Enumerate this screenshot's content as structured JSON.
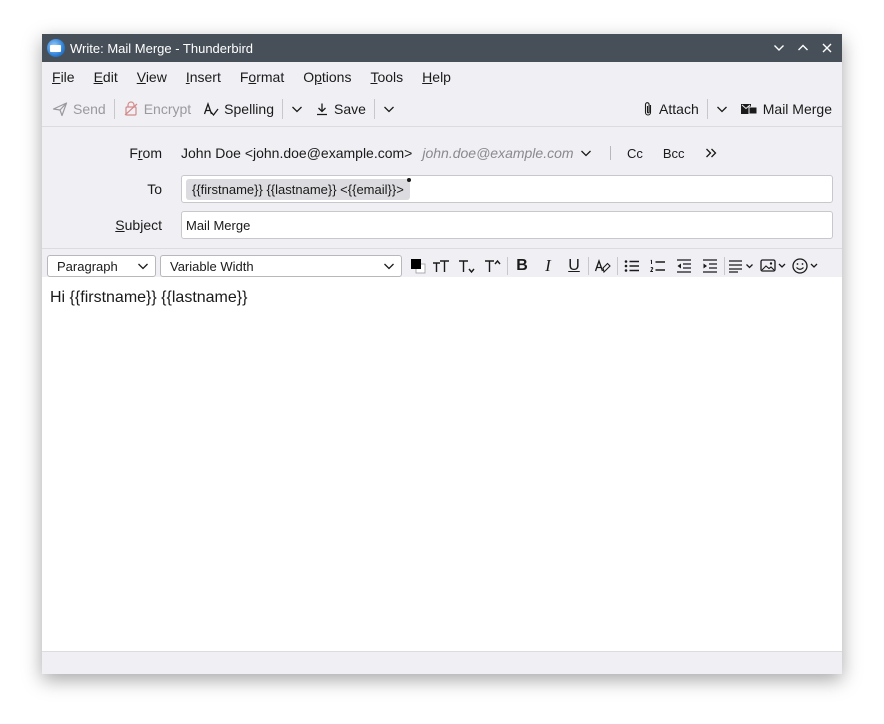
{
  "window": {
    "title": "Write: Mail Merge - Thunderbird"
  },
  "menubar": {
    "items": [
      {
        "pre": "",
        "key": "F",
        "post": "ile"
      },
      {
        "pre": "",
        "key": "E",
        "post": "dit"
      },
      {
        "pre": "",
        "key": "V",
        "post": "iew"
      },
      {
        "pre": "",
        "key": "I",
        "post": "nsert"
      },
      {
        "pre": "F",
        "key": "o",
        "post": "rmat"
      },
      {
        "pre": "O",
        "key": "p",
        "post": "tions"
      },
      {
        "pre": "",
        "key": "T",
        "post": "ools"
      },
      {
        "pre": "",
        "key": "H",
        "post": "elp"
      }
    ]
  },
  "toolbar": {
    "send": "Send",
    "encrypt": "Encrypt",
    "spelling": "Spelling",
    "save": "Save",
    "attach": "Attach",
    "mail_merge": "Mail Merge"
  },
  "headers": {
    "from_label_pre": "F",
    "from_label_key": "r",
    "from_label_post": "om",
    "from_value": "John Doe <john.doe@example.com>",
    "from_placeholder": "john.doe@example.com",
    "cc": "Cc",
    "bcc": "Bcc",
    "to_label": "To",
    "to_recipient": "{{firstname}} {{lastname}} <{{email}}>",
    "subject_label_key": "S",
    "subject_label_post": "ubject",
    "subject_value": "Mail Merge"
  },
  "format": {
    "paragraph": "Paragraph",
    "font": "Variable Width"
  },
  "body": {
    "text": "Hi {{firstname}} {{lastname}}"
  },
  "colors": {
    "titlebar": "#475059",
    "chrome": "#f0f0f4",
    "pill": "#dcdce0"
  }
}
